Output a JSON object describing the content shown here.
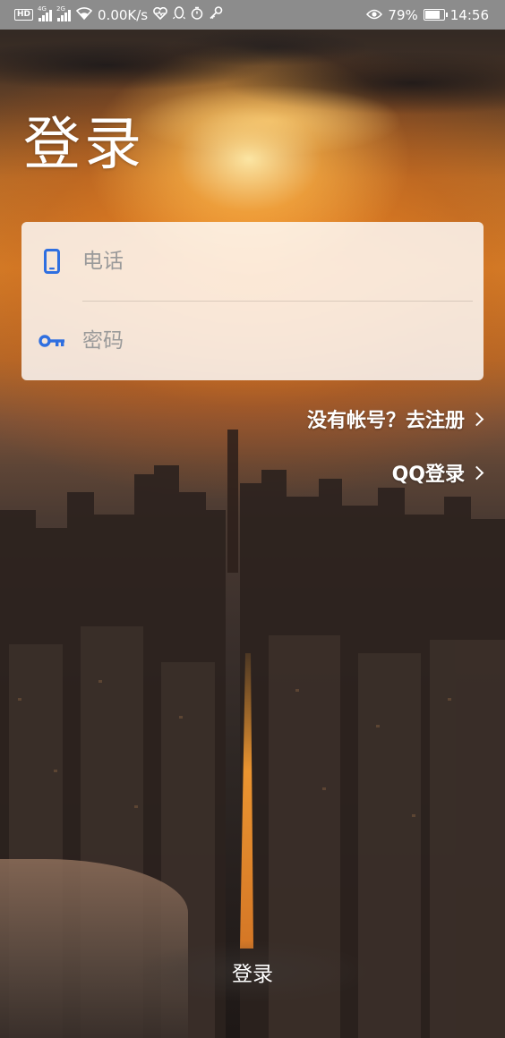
{
  "status_bar": {
    "hd": "HD",
    "signal1_tag": "4G",
    "signal2_tag": "2G",
    "net_speed": "0.00K/s",
    "battery_percent": "79%",
    "battery_level": 0.79,
    "time": "14:56",
    "icons": [
      "hd-icon",
      "signal-icon",
      "wifi-icon",
      "heart-rate-icon",
      "qq-icon",
      "timer-icon",
      "key-icon",
      "eye-icon",
      "battery-icon"
    ]
  },
  "page": {
    "title": "登录"
  },
  "form": {
    "phone_placeholder": "电话",
    "password_placeholder": "密码",
    "phone_icon": "phone-icon",
    "password_icon": "key-icon"
  },
  "links": {
    "register": "没有帐号？去注册",
    "qq_login": "QQ登录"
  },
  "login_button": {
    "label": "登录"
  },
  "colors": {
    "accent_icon": "#2f6fe0",
    "status_bar_bg": "#8c8c8c",
    "card_bg": "rgba(255,255,255,0.82)"
  }
}
